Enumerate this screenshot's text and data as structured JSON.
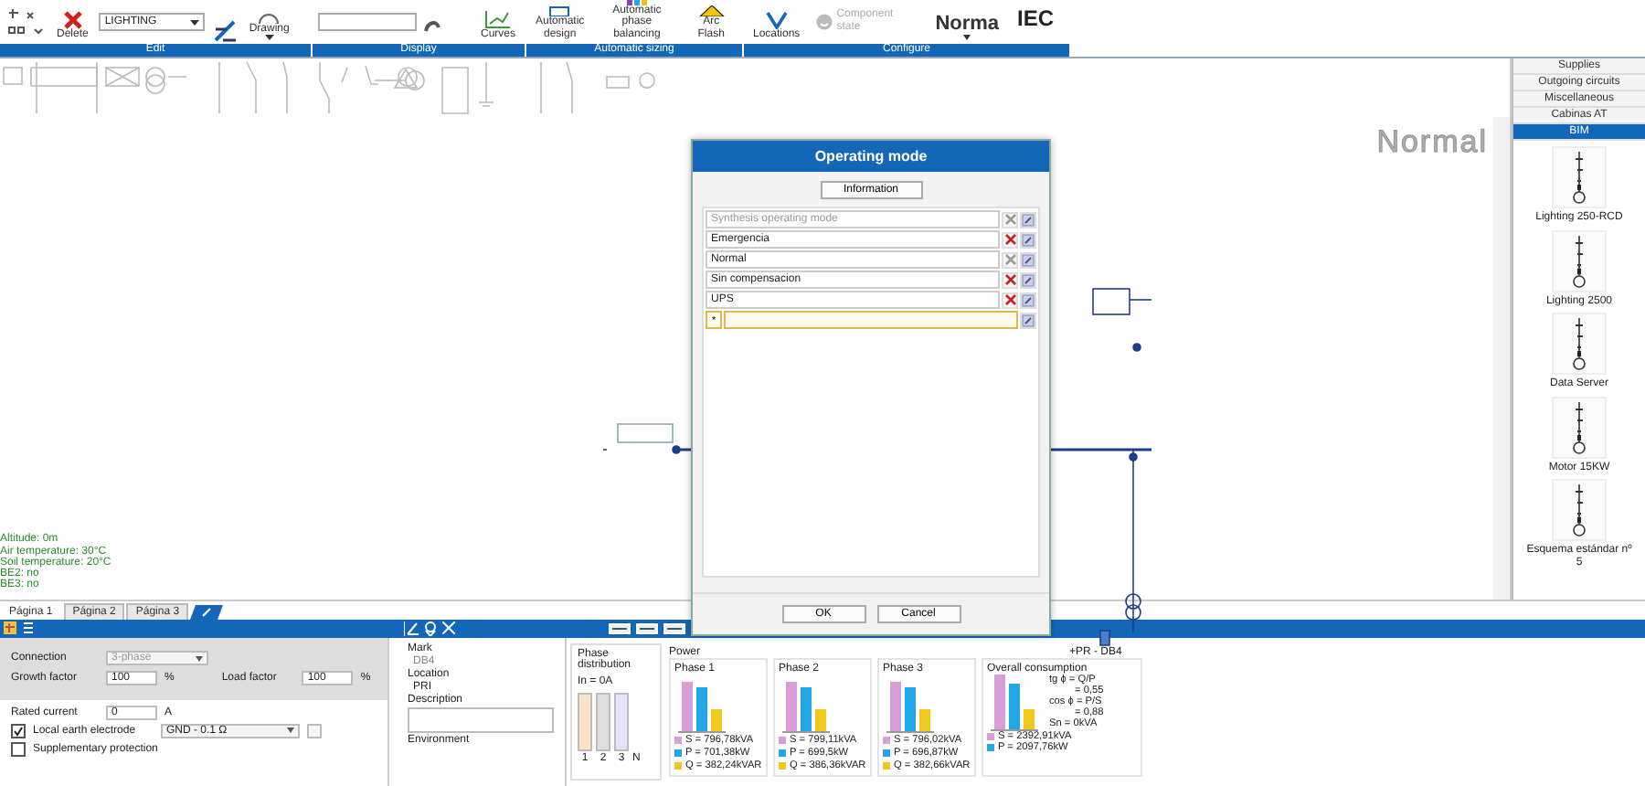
{
  "ribbon": {
    "groups": [
      {
        "kind": "edit",
        "label": "Edit",
        "delete_label": "Delete",
        "layer_value": "LIGHTING",
        "drawing_label": "Drawing"
      },
      {
        "kind": "display",
        "label": "Display",
        "curves_label": "Curves"
      },
      {
        "kind": "sizing",
        "label": "Automatic sizing",
        "buttons": [
          "Automatic design",
          "Automatic phase balancing",
          "Arc Flash"
        ]
      },
      {
        "kind": "configure",
        "label": "Configure",
        "locations_label": "Locations",
        "component_state": {
          "label": "Component state",
          "disabled": true
        },
        "standard_label": "Norma",
        "standard_value": "IEC"
      }
    ]
  },
  "canvas": {
    "mode_label": "Normal",
    "site_info": [
      "Altitude: 0m",
      "Air temperature: 30°C",
      "Soil temperature: 20°C",
      "BE2: no",
      "BE3: no"
    ]
  },
  "library": {
    "tabs": [
      {
        "label": "Supplies",
        "selected": false
      },
      {
        "label": "Outgoing circuits",
        "selected": false
      },
      {
        "label": "Miscellaneous",
        "selected": false
      },
      {
        "label": "Cabinas AT",
        "selected": false
      },
      {
        "label": "BIM",
        "selected": true
      }
    ],
    "items": [
      "Lighting 250-RCD",
      "Lighting 2500",
      "Data Server",
      "Motor 15KW",
      "Esquema estándar nº 5"
    ]
  },
  "page_tabs": [
    {
      "label": "Página 1",
      "selected": true
    },
    {
      "label": "Página 2",
      "selected": false
    },
    {
      "label": "Página 3",
      "selected": false
    }
  ],
  "properties": {
    "connection": {
      "label": "Connection",
      "value": "3-phase",
      "disabled": true
    },
    "growth_factor": {
      "label": "Growth factor",
      "value": "100",
      "unit": "%"
    },
    "load_factor": {
      "label": "Load factor",
      "value": "100",
      "unit": "%"
    },
    "rated_current": {
      "label": "Rated current",
      "value": "0",
      "unit": "A"
    },
    "local_earth": {
      "label": "Local earth electrode",
      "checked": true,
      "value": "GND - 0.1 Ω"
    },
    "supplementary": {
      "label": "Supplementary protection",
      "checked": false
    }
  },
  "identity": {
    "mark_label": "Mark",
    "mark": "DB4",
    "location_label": "Location",
    "location": "PRI",
    "description_label": "Description",
    "environment_label": "Environment"
  },
  "phase_distribution": {
    "title": "Phase distribution",
    "current": "In = 0A",
    "bar_labels": [
      "1",
      "2",
      "3",
      "N"
    ]
  },
  "power": {
    "title": "Power",
    "circuit": "+PR - DB4",
    "phases": [
      {
        "title": "Phase 1",
        "legend": [
          "S = 796,78kVA",
          "P = 701,38kW",
          "Q = 382,24kVAR"
        ]
      },
      {
        "title": "Phase 2",
        "legend": [
          "S = 799,11kVA",
          "P = 699,5kW",
          "Q = 386,36kVAR"
        ]
      },
      {
        "title": "Phase 3",
        "legend": [
          "S = 796,02kVA",
          "P = 696,87kW",
          "Q = 382,66kVAR"
        ]
      }
    ],
    "overall": {
      "title": "Overall consumption",
      "lines": [
        "tg ϕ = Q/P",
        "= 0,55",
        "cos ϕ = P/S",
        "= 0,88",
        "Sn = 0kVA"
      ],
      "legend": [
        "S = 2392,91kVA",
        "P = 2097,76kW"
      ]
    }
  },
  "dialog": {
    "title": "Operating mode",
    "info_button": "Information",
    "modes": [
      {
        "name": "Synthesis operating mode",
        "disabled": true,
        "removable": false
      },
      {
        "name": "Emergencia",
        "disabled": false,
        "removable": true
      },
      {
        "name": "Normal",
        "disabled": false,
        "removable": false
      },
      {
        "name": "Sin compensacion",
        "disabled": false,
        "removable": true
      },
      {
        "name": "UPS",
        "disabled": false,
        "removable": true
      }
    ],
    "new_row": {
      "marker": "*",
      "selected": true
    },
    "ok": "OK",
    "cancel": "Cancel"
  }
}
